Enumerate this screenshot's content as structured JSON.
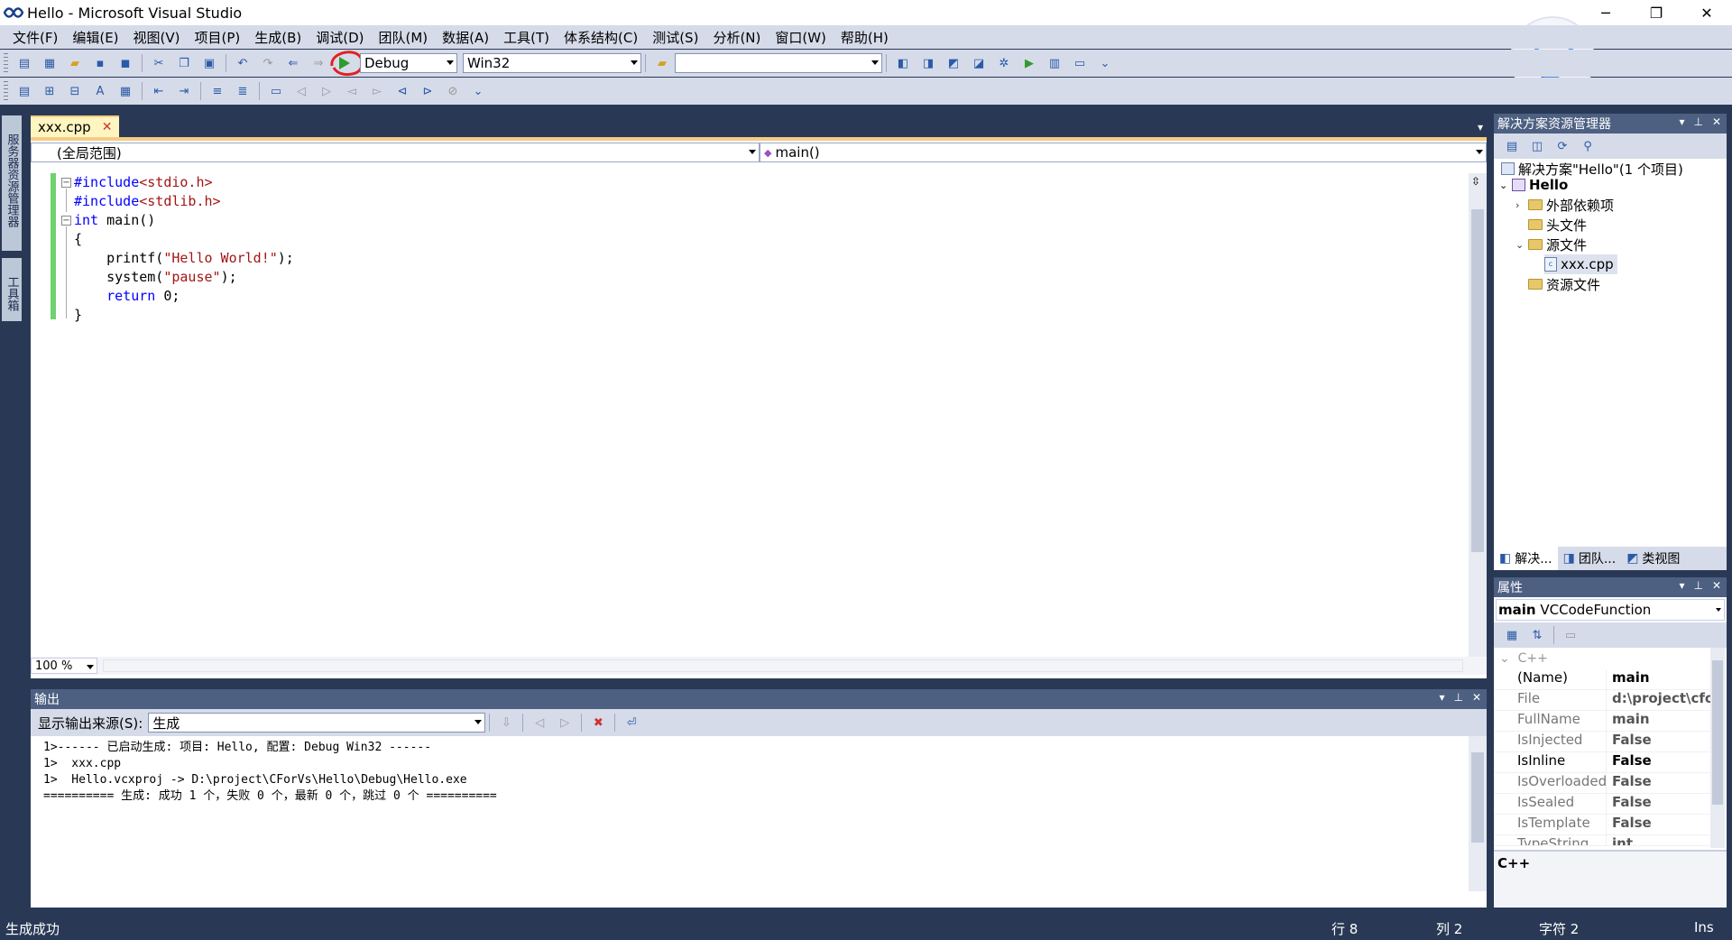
{
  "window": {
    "title": "Hello - Microsoft Visual Studio",
    "minimize": "─",
    "restore": "❐",
    "close": "✕"
  },
  "menu": [
    "文件(F)",
    "编辑(E)",
    "视图(V)",
    "项目(P)",
    "生成(B)",
    "调试(D)",
    "团队(M)",
    "数据(A)",
    "工具(T)",
    "体系结构(C)",
    "测试(S)",
    "分析(N)",
    "窗口(W)",
    "帮助(H)"
  ],
  "toolbar": {
    "config": "Debug",
    "platform": "Win32",
    "find_value": "",
    "start_icon": "play-icon"
  },
  "left_strip": {
    "server_explorer": "服务器资源管理器",
    "toolbox": "工具箱"
  },
  "editor": {
    "tab_label": "xxx.cpp",
    "tab_close": "✕",
    "scope": "(全局范围)",
    "member": "main()",
    "zoom": "100 %",
    "code_lines": [
      {
        "a": "#include",
        "b": "<stdio.h>",
        "c": ""
      },
      {
        "a": "#include",
        "b": "<stdlib.h>",
        "c": ""
      },
      {
        "a": "int",
        "b": "",
        "c": " main()"
      },
      {
        "a": "",
        "b": "",
        "c": "{"
      },
      {
        "a": "",
        "b": "\"Hello World!\"",
        "c": "    printf(",
        "d": ");"
      },
      {
        "a": "",
        "b": "\"pause\"",
        "c": "    system(",
        "d": ");"
      },
      {
        "a": "return",
        "b": "",
        "c": "    ",
        "d": " 0;"
      },
      {
        "a": "",
        "b": "",
        "c": "}"
      }
    ]
  },
  "output": {
    "title": "输出",
    "source_label": "显示输出来源(S):",
    "source_value": "生成",
    "lines": [
      "1>------ 已启动生成: 项目: Hello, 配置: Debug Win32 ------",
      "1>  xxx.cpp",
      "1>  Hello.vcxproj -> D:\\project\\CForVs\\Hello\\Debug\\Hello.exe",
      "========== 生成: 成功 1 个，失败 0 个，最新 0 个，跳过 0 个 =========="
    ]
  },
  "solution_explorer": {
    "title": "解决方案资源管理器",
    "solution": "解决方案\"Hello\"(1 个项目)",
    "project": "Hello",
    "external_deps": "外部依赖项",
    "headers": "头文件",
    "sources": "源文件",
    "source_file": "xxx.cpp",
    "resources": "资源文件",
    "tabs": [
      "解决...",
      "团队...",
      "类视图"
    ]
  },
  "properties": {
    "title": "属性",
    "object_name": "main",
    "object_type": "VCCodeFunction",
    "category": "C++",
    "rows": [
      {
        "name": "(Name)",
        "value": "main"
      },
      {
        "name": "File",
        "value": "d:\\project\\cfo"
      },
      {
        "name": "FullName",
        "value": "main"
      },
      {
        "name": "IsInjected",
        "value": "False"
      },
      {
        "name": "IsInline",
        "value": "False"
      },
      {
        "name": "IsOverloaded",
        "value": "False"
      },
      {
        "name": "IsSealed",
        "value": "False"
      },
      {
        "name": "IsTemplate",
        "value": "False"
      },
      {
        "name": "TypeString",
        "value": "int"
      }
    ],
    "description": "C++"
  },
  "status": {
    "message": "生成成功",
    "line": "行 8",
    "col": "列 2",
    "char": "字符 2",
    "mode": "Ins"
  }
}
